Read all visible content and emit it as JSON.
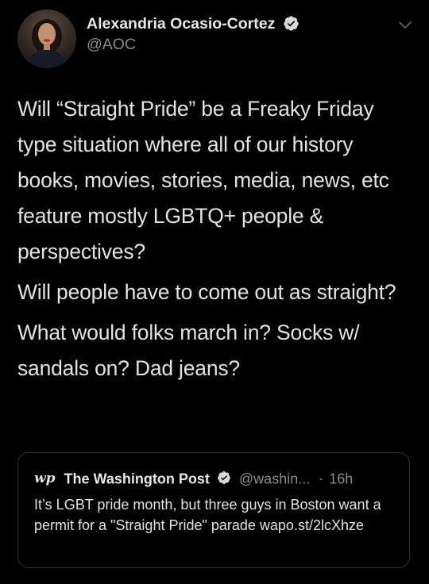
{
  "author": {
    "display_name": "Alexandria Ocasio-Cortez",
    "handle": "@AOC",
    "verified": true,
    "avatar_icon": "profile-photo"
  },
  "tweet": {
    "paragraphs": [
      "Will “Straight Pride” be a Freaky Friday type situation where all of our history books, movies, stories, media, news, etc feature mostly LGBTQ+ people & perspectives?",
      "Will people have to come out as straight?",
      "What would folks march in? Socks w/ sandals on? Dad jeans?"
    ]
  },
  "quoted_tweet": {
    "logo_text": "wp",
    "display_name": "The Washington Post",
    "verified": true,
    "handle": "@washin...",
    "separator": "·",
    "time": "16h",
    "text": "It’s LGBT pride month, but three guys in Boston want a permit for a \"Straight Pride\" parade wapo.st/2lcXhze"
  },
  "colors": {
    "background": "#000000",
    "verified_badge": "#d9d9d9",
    "secondary_text": "#8b8b8b",
    "border": "#2f2f2f"
  }
}
